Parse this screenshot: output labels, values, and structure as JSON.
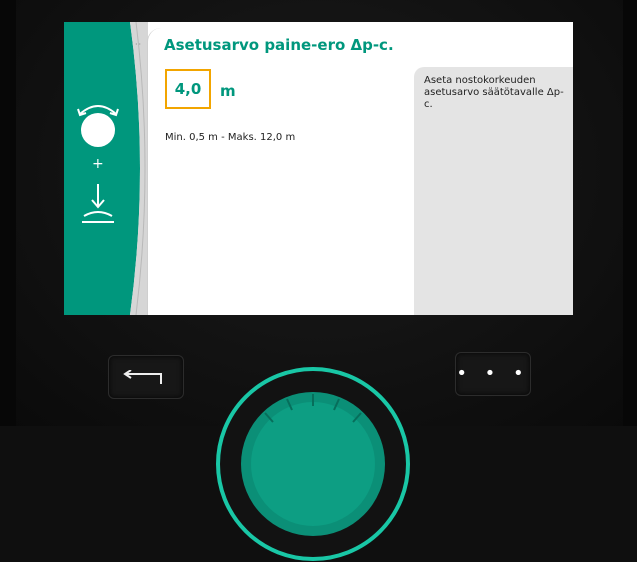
{
  "screen": {
    "title": "Asetusarvo paine-ero Δp-c.",
    "value": "4,0",
    "unit": "m",
    "range_text": "Min. 0,5 m - Maks. 12,0 m",
    "help_text": "Aseta nostokorkeuden asetusarvo säätötavalle Δp-c.",
    "overflow_dots": "··"
  },
  "colors": {
    "accent_green": "#00977d",
    "focus_orange": "#f2a500",
    "help_bg": "#e4e4e4"
  },
  "icons": {
    "panel_top": "rotate-knob-icon",
    "panel_plus": "+",
    "panel_bottom": "press-knob-icon"
  },
  "hardware": {
    "back_button": "back-icon",
    "context_button_dots": "• • •",
    "knob": "control-knob"
  }
}
